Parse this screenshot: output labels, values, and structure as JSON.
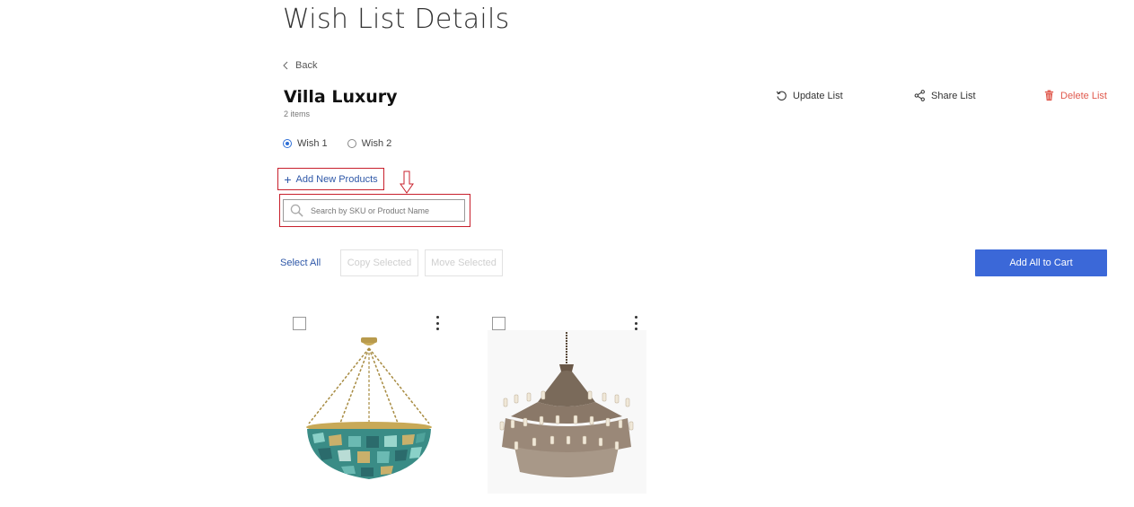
{
  "page": {
    "title": "Wish List Details",
    "back_label": "Back"
  },
  "list": {
    "name": "Villa Luxury",
    "item_count": "2 items"
  },
  "actions": {
    "update": "Update List",
    "share": "Share List",
    "delete": "Delete List"
  },
  "wishes": [
    {
      "label": "Wish 1",
      "selected": true
    },
    {
      "label": "Wish 2",
      "selected": false
    }
  ],
  "add_products": {
    "label": "Add New Products"
  },
  "search": {
    "placeholder": "Search by SKU or Product Name",
    "value": ""
  },
  "toolbar": {
    "select_all": "Select All",
    "copy_selected": "Copy Selected",
    "move_selected": "Move Selected",
    "add_all_to_cart": "Add All to Cart"
  },
  "colors": {
    "link_blue": "#2f58a8",
    "primary_button": "#3b68d8",
    "delete_red": "#e05a4e",
    "annotation_red": "#c8202c"
  },
  "products": [
    {
      "image": "teal-glass-chandelier",
      "checked": false
    },
    {
      "image": "crystal-chain-chandelier",
      "checked": false
    }
  ]
}
